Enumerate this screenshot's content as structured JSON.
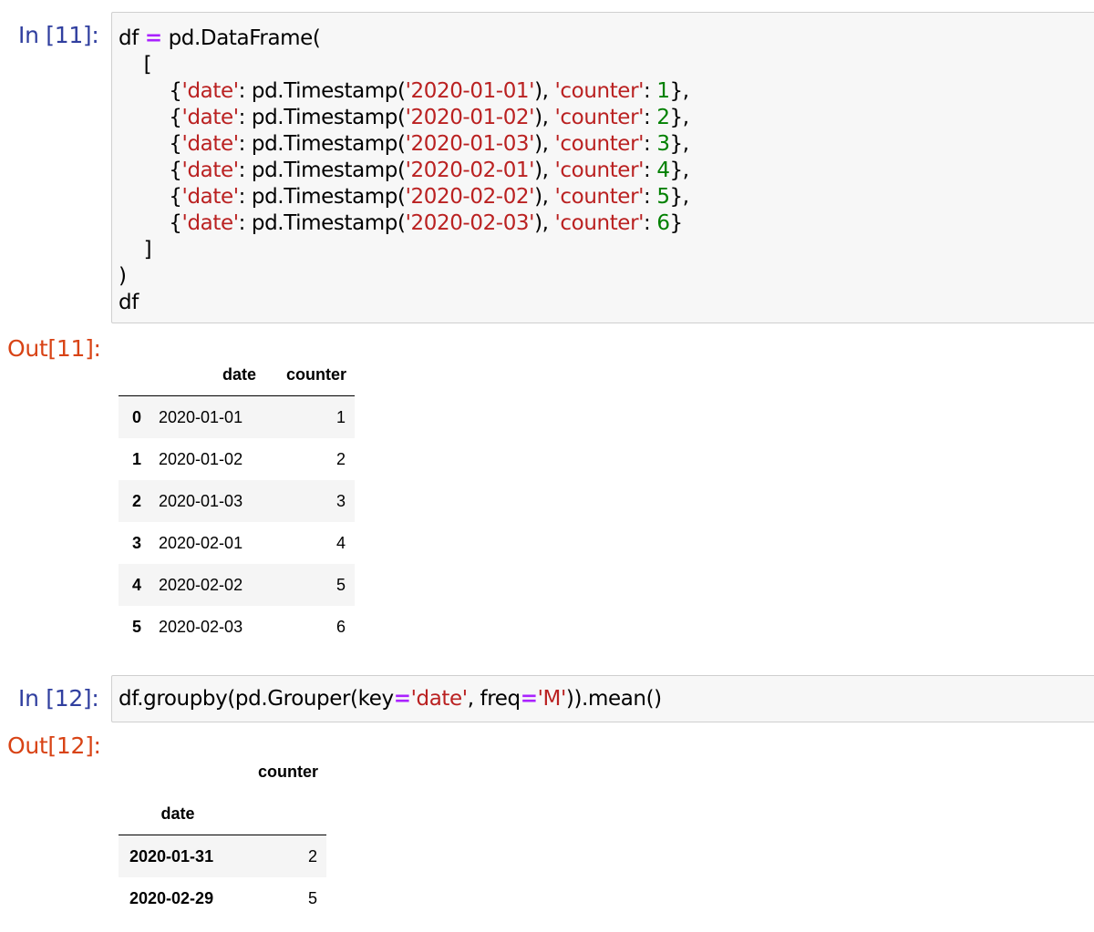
{
  "cells": [
    {
      "in_prompt": "In [11]:",
      "out_prompt": "Out[11]:",
      "code_lines": [
        [
          {
            "t": "df "
          },
          {
            "t": "=",
            "c": "op"
          },
          {
            "t": " pd.DataFrame("
          }
        ],
        [
          {
            "t": "    ["
          }
        ],
        [
          {
            "t": "        {"
          },
          {
            "t": "'date'",
            "c": "str"
          },
          {
            "t": ": pd.Timestamp("
          },
          {
            "t": "'2020-01-01'",
            "c": "str"
          },
          {
            "t": "), "
          },
          {
            "t": "'counter'",
            "c": "str"
          },
          {
            "t": ": "
          },
          {
            "t": "1",
            "c": "num"
          },
          {
            "t": "},"
          }
        ],
        [
          {
            "t": "        {"
          },
          {
            "t": "'date'",
            "c": "str"
          },
          {
            "t": ": pd.Timestamp("
          },
          {
            "t": "'2020-01-02'",
            "c": "str"
          },
          {
            "t": "), "
          },
          {
            "t": "'counter'",
            "c": "str"
          },
          {
            "t": ": "
          },
          {
            "t": "2",
            "c": "num"
          },
          {
            "t": "},"
          }
        ],
        [
          {
            "t": "        {"
          },
          {
            "t": "'date'",
            "c": "str"
          },
          {
            "t": ": pd.Timestamp("
          },
          {
            "t": "'2020-01-03'",
            "c": "str"
          },
          {
            "t": "), "
          },
          {
            "t": "'counter'",
            "c": "str"
          },
          {
            "t": ": "
          },
          {
            "t": "3",
            "c": "num"
          },
          {
            "t": "},"
          }
        ],
        [
          {
            "t": "        {"
          },
          {
            "t": "'date'",
            "c": "str"
          },
          {
            "t": ": pd.Timestamp("
          },
          {
            "t": "'2020-02-01'",
            "c": "str"
          },
          {
            "t": "), "
          },
          {
            "t": "'counter'",
            "c": "str"
          },
          {
            "t": ": "
          },
          {
            "t": "4",
            "c": "num"
          },
          {
            "t": "},"
          }
        ],
        [
          {
            "t": "        {"
          },
          {
            "t": "'date'",
            "c": "str"
          },
          {
            "t": ": pd.Timestamp("
          },
          {
            "t": "'2020-02-02'",
            "c": "str"
          },
          {
            "t": "), "
          },
          {
            "t": "'counter'",
            "c": "str"
          },
          {
            "t": ": "
          },
          {
            "t": "5",
            "c": "num"
          },
          {
            "t": "},"
          }
        ],
        [
          {
            "t": "        {"
          },
          {
            "t": "'date'",
            "c": "str"
          },
          {
            "t": ": pd.Timestamp("
          },
          {
            "t": "'2020-02-03'",
            "c": "str"
          },
          {
            "t": "), "
          },
          {
            "t": "'counter'",
            "c": "str"
          },
          {
            "t": ": "
          },
          {
            "t": "6",
            "c": "num"
          },
          {
            "t": "}"
          }
        ],
        [
          {
            "t": "    ]"
          }
        ],
        [
          {
            "t": ")"
          }
        ],
        [
          {
            "t": "df"
          }
        ]
      ],
      "output": {
        "columns": [
          "date",
          "counter"
        ],
        "rows": [
          {
            "index": "0",
            "date": "2020-01-01",
            "counter": "1"
          },
          {
            "index": "1",
            "date": "2020-01-02",
            "counter": "2"
          },
          {
            "index": "2",
            "date": "2020-01-03",
            "counter": "3"
          },
          {
            "index": "3",
            "date": "2020-02-01",
            "counter": "4"
          },
          {
            "index": "4",
            "date": "2020-02-02",
            "counter": "5"
          },
          {
            "index": "5",
            "date": "2020-02-03",
            "counter": "6"
          }
        ]
      }
    },
    {
      "in_prompt": "In [12]:",
      "out_prompt": "Out[12]:",
      "code_lines": [
        [
          {
            "t": "df.groupby(pd.Grouper(key"
          },
          {
            "t": "=",
            "c": "op"
          },
          {
            "t": "'date'",
            "c": "str"
          },
          {
            "t": ", freq"
          },
          {
            "t": "=",
            "c": "op"
          },
          {
            "t": "'M'",
            "c": "str"
          },
          {
            "t": ")).mean()"
          }
        ]
      ],
      "output": {
        "column": "counter",
        "index_name": "date",
        "rows": [
          {
            "index": "2020-01-31",
            "counter": "2"
          },
          {
            "index": "2020-02-29",
            "counter": "5"
          }
        ]
      }
    }
  ]
}
